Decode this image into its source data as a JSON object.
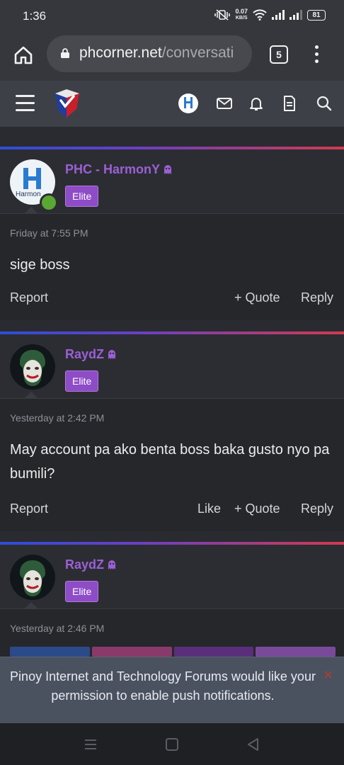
{
  "status_bar": {
    "time": "1:36",
    "net_speed_value": "0.07",
    "net_speed_unit": "KB/S",
    "battery": "81"
  },
  "browser": {
    "url_domain": "phcorner.net",
    "url_path": "/conversati",
    "tab_count": "5"
  },
  "header": {
    "icons": [
      "menu-icon",
      "logo",
      "avatar",
      "mail-icon",
      "bell-icon",
      "document-icon",
      "search-icon"
    ]
  },
  "posts": [
    {
      "username": "PHC - HarmonY",
      "badge": "Elite",
      "avatar_text": "Harmon",
      "date": "Friday at 7:55 PM",
      "body": "sige boss",
      "actions": {
        "report": "Report",
        "quote": "+ Quote",
        "reply": "Reply"
      }
    },
    {
      "username": "RaydZ",
      "badge": "Elite",
      "date": "Yesterday at 2:42 PM",
      "body": "May account pa ako benta boss baka gusto nyo pa bumili?",
      "actions": {
        "report": "Report",
        "like": "Like",
        "quote": "+ Quote",
        "reply": "Reply"
      }
    },
    {
      "username": "RaydZ",
      "badge": "Elite",
      "date": "Yesterday at 2:46 PM"
    }
  ],
  "push_banner": {
    "text": "Pinoy Internet and Technology Forums would like your permission to enable push notifications.",
    "close": "×"
  },
  "colors": {
    "username": "#9b5fd6",
    "badge": "#8e4cc7",
    "online": "#5aa832",
    "close": "#c0392b"
  }
}
